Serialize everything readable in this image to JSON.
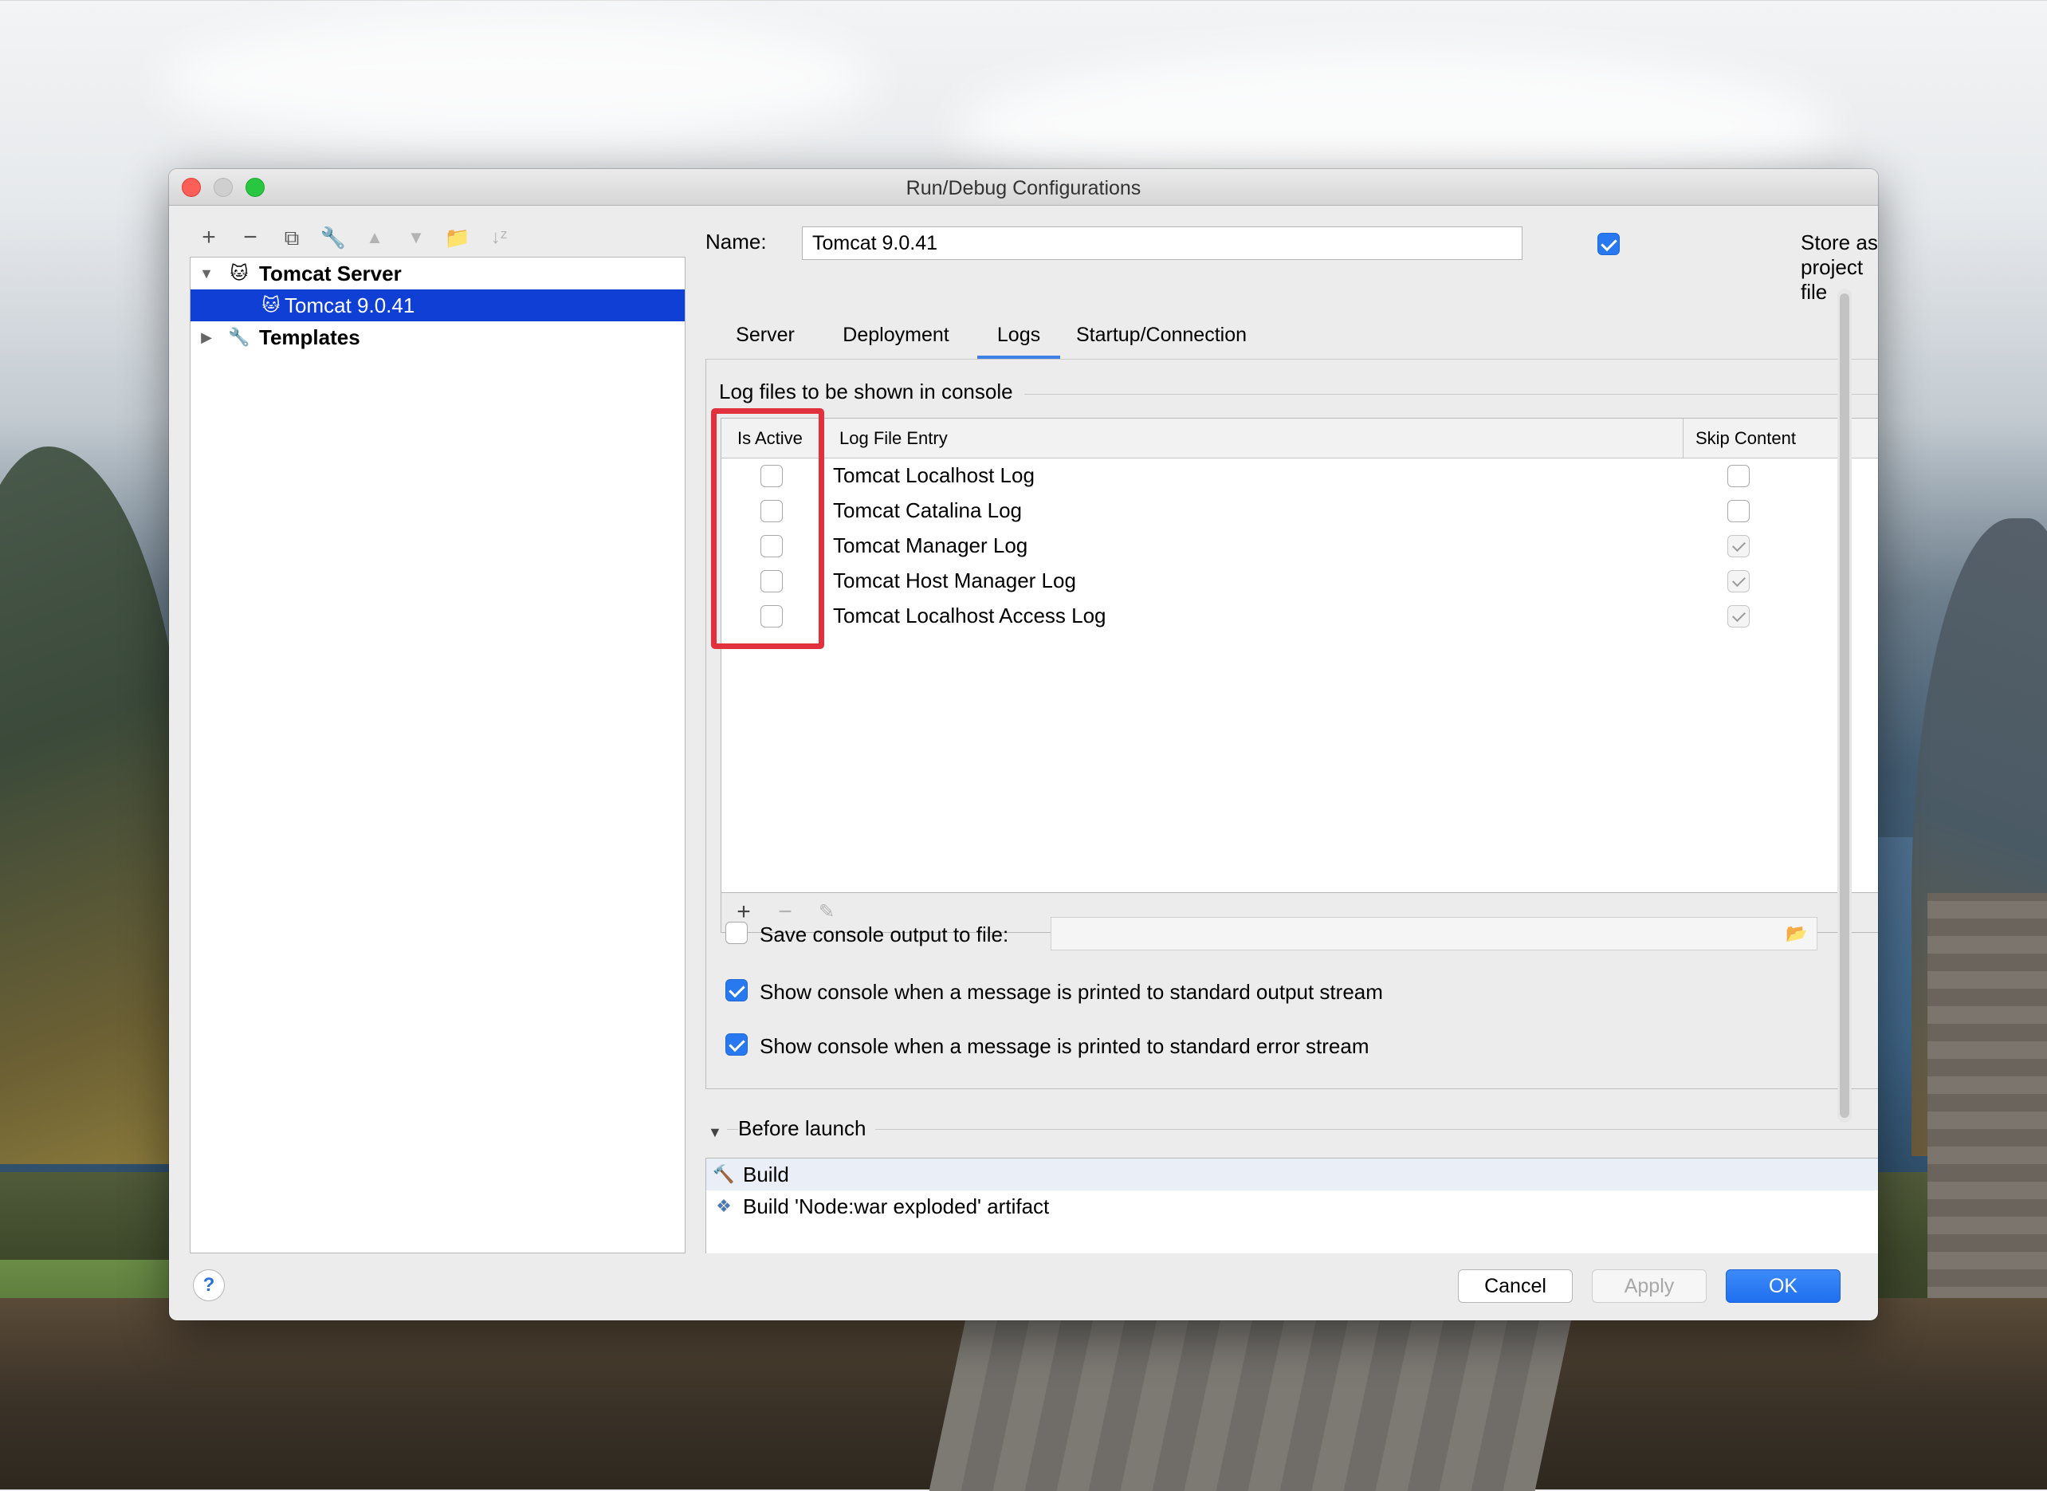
{
  "window": {
    "title": "Run/Debug Configurations"
  },
  "toolbar": {
    "icons": [
      "plus-icon",
      "minus-icon",
      "copy-icon",
      "wrench-icon",
      "arrow-up-icon",
      "arrow-down-icon",
      "new-folder-icon",
      "sort-icon"
    ]
  },
  "tree": {
    "items": [
      {
        "label": "Tomcat Server",
        "expanded": true
      },
      {
        "label": "Tomcat 9.0.41",
        "selected": true
      },
      {
        "label": "Templates",
        "expanded": false
      }
    ]
  },
  "name": {
    "label": "Name:",
    "value": "Tomcat 9.0.41"
  },
  "store": {
    "label": "Store as project file",
    "checked": true
  },
  "tabs": [
    {
      "label": "Server",
      "active": false
    },
    {
      "label": "Deployment",
      "active": false
    },
    {
      "label": "Logs",
      "active": true
    },
    {
      "label": "Startup/Connection",
      "active": false
    }
  ],
  "logs": {
    "section_title": "Log files to be shown in console",
    "columns": {
      "active": "Is Active",
      "entry": "Log File Entry",
      "skip": "Skip Content"
    },
    "rows": [
      {
        "entry": "Tomcat Localhost Log",
        "active": false,
        "skip": false
      },
      {
        "entry": "Tomcat Catalina Log",
        "active": false,
        "skip": false
      },
      {
        "entry": "Tomcat Manager Log",
        "active": false,
        "skip": true
      },
      {
        "entry": "Tomcat Host Manager Log",
        "active": false,
        "skip": true
      },
      {
        "entry": "Tomcat Localhost Access Log",
        "active": false,
        "skip": true
      }
    ]
  },
  "options": {
    "save_console": {
      "label": "Save console output to file:",
      "checked": false,
      "value": ""
    },
    "show_stdout": {
      "label": "Show console when a message is printed to standard output stream",
      "checked": true
    },
    "show_stderr": {
      "label": "Show console when a message is printed to standard error stream",
      "checked": true
    }
  },
  "before_launch": {
    "title": "Before launch",
    "items": [
      {
        "label": "Build",
        "icon": "hammer-icon"
      },
      {
        "label": "Build 'Node:war exploded' artifact",
        "icon": "artifact-icon"
      }
    ]
  },
  "buttons": {
    "help": "?",
    "cancel": "Cancel",
    "apply": "Apply",
    "ok": "OK"
  },
  "colors": {
    "accent": "#2878f0",
    "selection": "#0f3fd5",
    "highlight": "#e0313d"
  }
}
